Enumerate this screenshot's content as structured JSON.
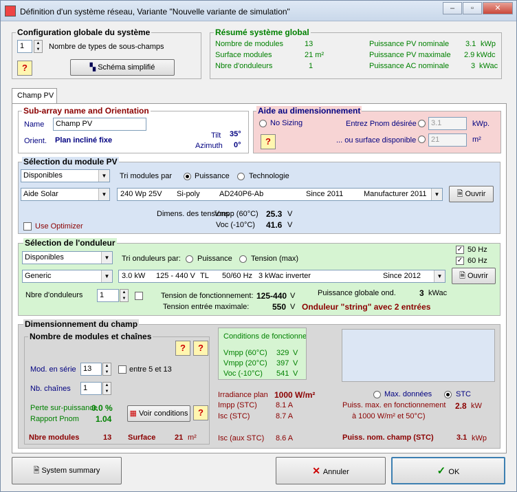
{
  "window": {
    "title": "Définition d'un système réseau, Variante   \"Nouvelle variante de simulation\""
  },
  "config": {
    "title": "Configuration globale du système",
    "subfields_value": "1",
    "subfields_label": "Nombre de types de sous-champs",
    "schema_button": "Schéma simplifié"
  },
  "summary": {
    "title": "Résumé système global",
    "rows": [
      {
        "label": "Nombre de modules",
        "value": "13",
        "label2": "Puissance PV nominale",
        "value2": "3.1",
        "unit2": "kWp"
      },
      {
        "label": "Surface modules",
        "value": "21 m²",
        "label2": "Puissance PV maximale",
        "value2": "2.9",
        "unit2": "kWdc"
      },
      {
        "label": "Nbre d'onduleurs",
        "value": "1",
        "label2": "Puissance AC nominale",
        "value2": "3",
        "unit2": "kWac"
      }
    ]
  },
  "tab": {
    "label": "Champ PV"
  },
  "subarray": {
    "title": "Sub-array name and Orientation",
    "name_label": "Name",
    "name_value": "Champ PV",
    "orient_label": "Orient.",
    "orient_value": "Plan incliné fixe",
    "tilt_label": "Tilt",
    "tilt_value": "35°",
    "azimuth_label": "Azimuth",
    "azimuth_value": "0°"
  },
  "sizing": {
    "title": "Aide au dimensionnement",
    "no_sizing": "No Sizing",
    "pnom_label": "Entrez Pnom désirée",
    "pnom_value": "3.1",
    "pnom_unit": "kWp.",
    "surface_label": "... ou surface disponible",
    "surface_value": "21",
    "surface_unit": "m²"
  },
  "module": {
    "title": "Sélection du module PV",
    "filter": "Disponibles",
    "sort_label": "Tri modules par",
    "sort_power": "Puissance",
    "sort_tech": "Technologie",
    "manufacturer": "Aide Solar",
    "model": {
      "power": "240 Wp 25V",
      "tech": "Si-poly",
      "ref": "AD240P6-Ab",
      "since": "Since 2011",
      "source": "Manufacturer 2011"
    },
    "open_button": "Ouvrir",
    "dim_label": "Dimens. des tensions :",
    "vmpp_label": "Vmpp (60°C)",
    "vmpp_value": "25.3",
    "voc_label": "Voc (-10°C)",
    "voc_value": "41.6",
    "volt_unit": "V",
    "optimizer_label": "Use Optimizer"
  },
  "inverter": {
    "title": "Sélection de l'onduleur",
    "filter": "Disponibles",
    "sort_label": "Tri onduleurs par:",
    "sort_power": "Puissance",
    "sort_voltage": "Tension (max)",
    "hz50": "50 Hz",
    "hz60": "60 Hz",
    "manufacturer": "Generic",
    "model": {
      "power": "3.0 kW",
      "range": "125 - 440 V",
      "type": "TL",
      "freq": "50/60 Hz",
      "name": "3 kWac inverter",
      "since": "Since 2012"
    },
    "open_button": "Ouvrir",
    "count_label": "Nbre d'onduleurs",
    "count_value": "1",
    "op_voltage_label": "Tension de fonctionnement:",
    "op_voltage_value": "125-440",
    "global_power_label": "Puissance globale ond.",
    "global_power_value": "3",
    "global_power_unit": "kWac",
    "max_input_label": "Tension entrée maximale:",
    "max_input_value": "550",
    "volt_unit": "V",
    "string_note": "Onduleur \"string\" avec 2 entrées"
  },
  "design": {
    "title": "Dimensionnement du champ",
    "modules_title": "Nombre de modules et chaînes",
    "series_label": "Mod. en série",
    "series_value": "13",
    "series_range": "entre 5 et 13",
    "strings_label": "Nb. chaînes",
    "strings_value": "1",
    "overload_label": "Perte sur-puissance",
    "overload_value": "0.0 %",
    "ratio_label": "Rapport Pnom",
    "ratio_value": "1.04",
    "view_button": "Voir conditions",
    "total_modules_label": "Nbre modules",
    "total_modules_value": "13",
    "surface_label": "Surface",
    "surface_value": "21",
    "surface_unit": "m²",
    "conditions_title": "Conditions de fonctionnem",
    "conditions": [
      {
        "label": "Vmpp (60°C)",
        "value": "329",
        "unit": "V"
      },
      {
        "label": "Vmpp (20°C)",
        "value": "397",
        "unit": "V"
      },
      {
        "label": "Voc  (-10°C)",
        "value": "541",
        "unit": "V"
      }
    ],
    "irradiance_label": "Irradiance plan",
    "irradiance_value": "1000 W/m²",
    "impp_label": "Impp (STC)",
    "impp_value": "8.1 A",
    "isc_label": "Isc  (STC)",
    "isc_value": "8.7 A",
    "isc_aux_label": "Isc (aux STC)",
    "isc_aux_value": "8.6 A",
    "max_data": "Max. données",
    "stc": "STC",
    "pmax_label1": "Puiss. max. en fonctionnement",
    "pmax_label2": "à 1000 W/m² et 50°C)",
    "pmax_value": "2.8",
    "pmax_unit": "kW",
    "pnom_label": "Puiss. nom. champ (STC)",
    "pnom_value": "3.1",
    "pnom_unit": "kWp"
  },
  "footer": {
    "summary_button": "System summary",
    "cancel_button": "Annuler",
    "ok_button": "OK"
  },
  "colors": {
    "summary_green": "#008000",
    "sizing_bg": "#f7d4d4",
    "module_bg": "#d8e4f4",
    "inverter_bg": "#d6f4d2",
    "navy": "#000080",
    "darkred": "#8b0000"
  }
}
